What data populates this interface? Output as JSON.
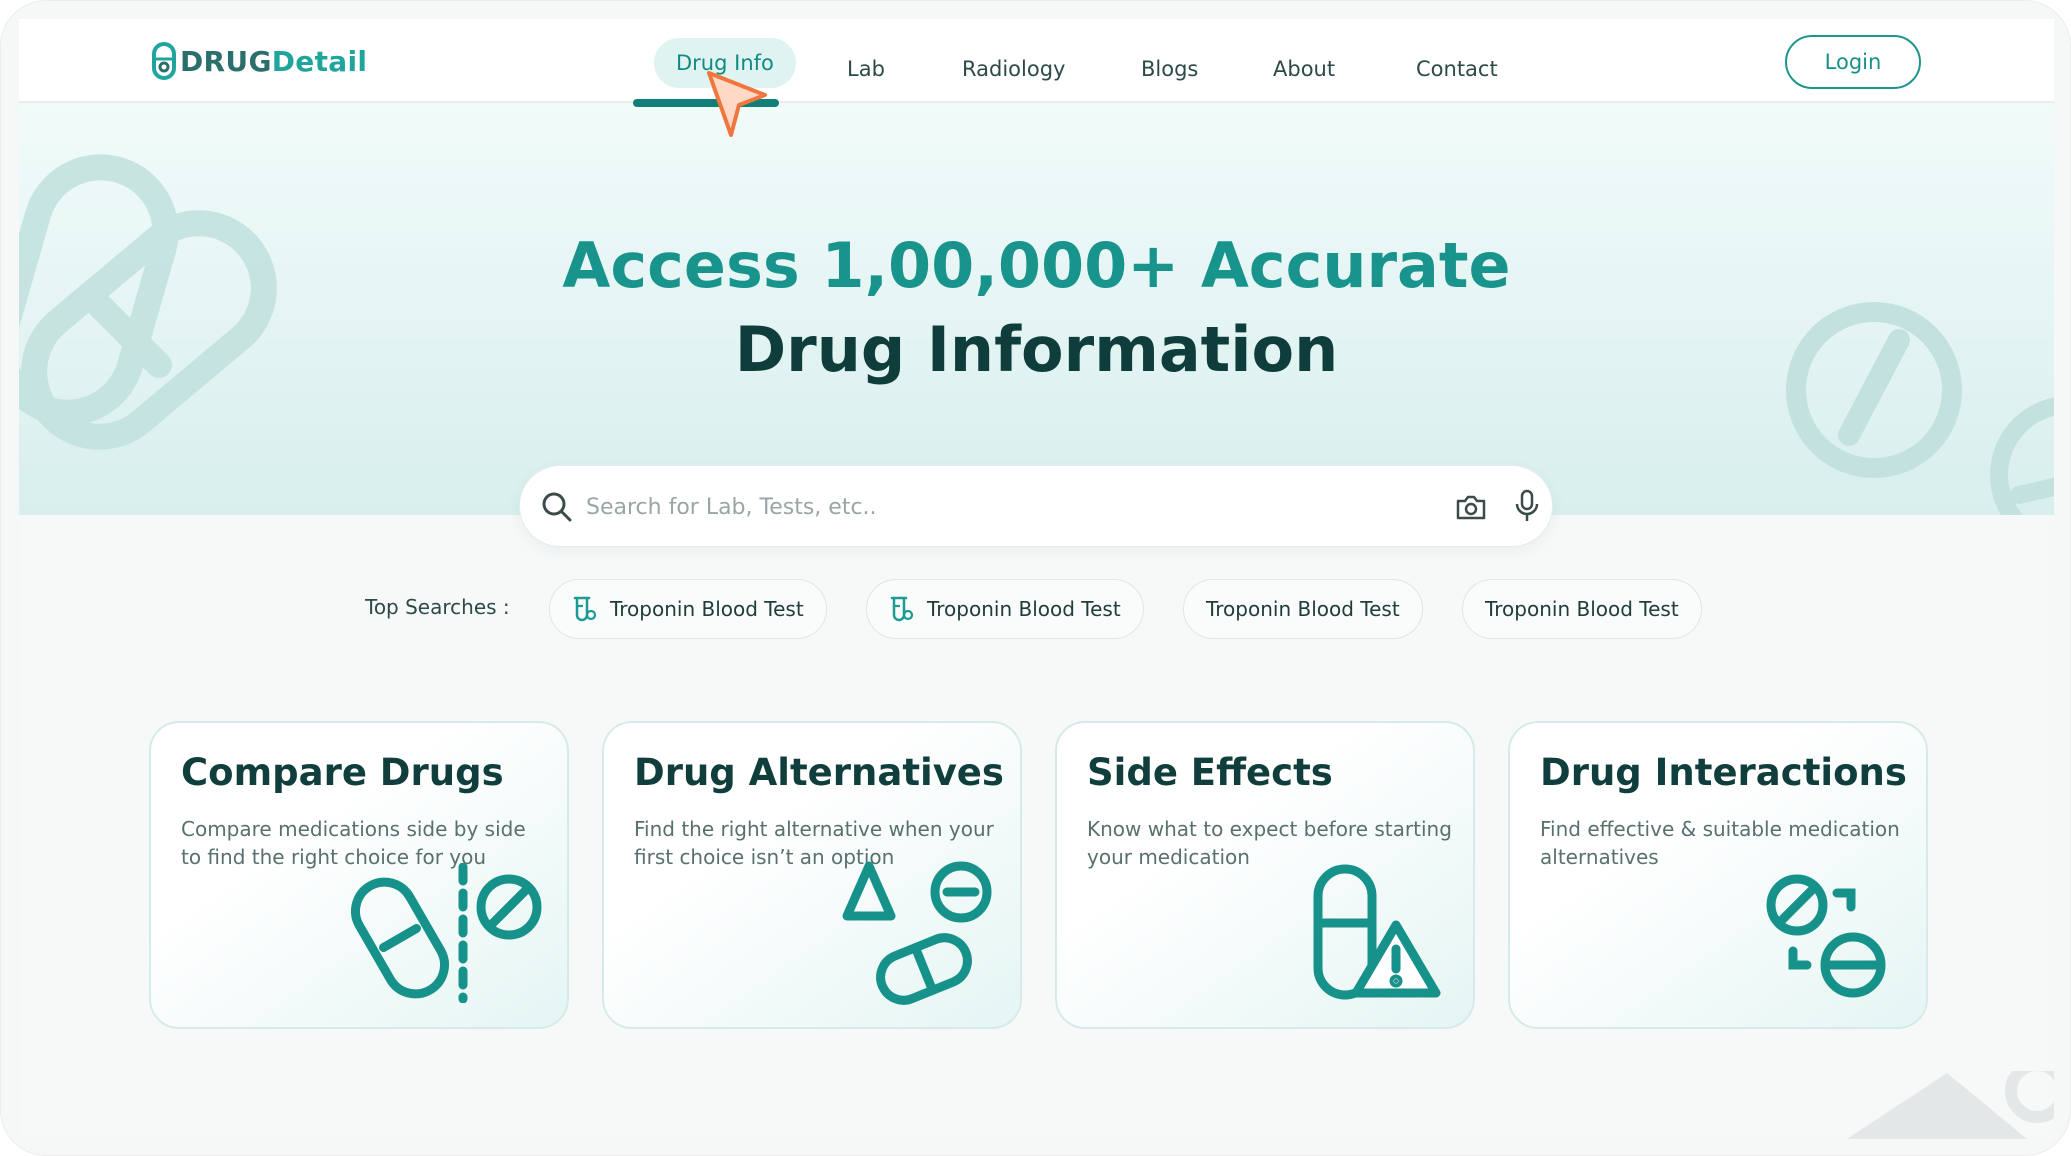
{
  "brand": {
    "name_part1": "DRUG",
    "name_part2": "Detail"
  },
  "nav": {
    "items": [
      {
        "label": "Drug Info",
        "active": true
      },
      {
        "label": "Lab"
      },
      {
        "label": "Radiology"
      },
      {
        "label": "Blogs"
      },
      {
        "label": "About"
      },
      {
        "label": "Contact"
      }
    ],
    "login_label": "Login"
  },
  "hero": {
    "title_line1": "Access 1,00,000+ Accurate",
    "title_line2": "Drug Information"
  },
  "search": {
    "placeholder": "Search for Lab, Tests, etc..",
    "value": ""
  },
  "top_searches": {
    "label": "Top Searches :",
    "chips": [
      {
        "label": "Troponin Blood Test",
        "icon": "lab-flask-icon"
      },
      {
        "label": "Troponin Blood Test",
        "icon": "lab-flask-icon"
      },
      {
        "label": "Troponin Blood Test"
      },
      {
        "label": "Troponin Blood Test"
      }
    ]
  },
  "cards": [
    {
      "title": "Compare Drugs",
      "desc": "Compare medications side by side to find the right choice for you",
      "icon": "compare-pills-icon"
    },
    {
      "title": "Drug Alternatives",
      "desc": "Find the right alternative when your first choice isn’t an option",
      "icon": "alternative-pills-icon"
    },
    {
      "title": "Side Effects",
      "desc": "Know what to expect before starting your medication",
      "icon": "side-effect-warning-icon"
    },
    {
      "title": "Drug Interactions",
      "desc": "Find effective & suitable medication alternatives",
      "icon": "interaction-pills-icon"
    }
  ],
  "colors": {
    "brand_teal": "#19948d",
    "dark_teal": "#0f3d3b",
    "accent_orange": "#f0763d"
  }
}
